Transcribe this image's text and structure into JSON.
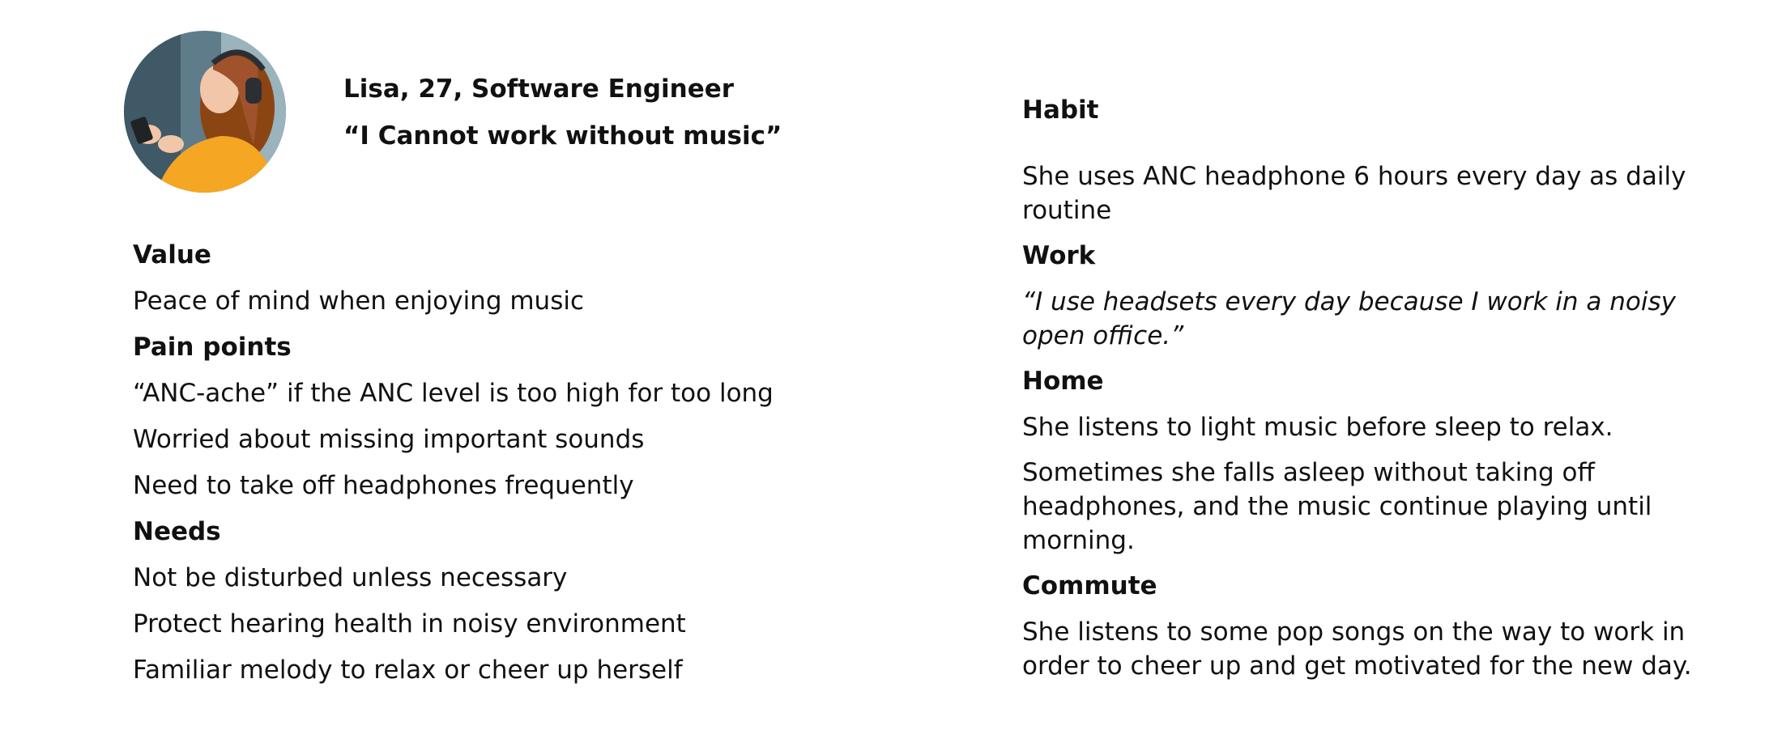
{
  "persona": {
    "name_line": "Lisa, 27, Software Engineer",
    "quote": "“I Cannot work without music”",
    "photo_colors": {
      "background": "#5e7c8a",
      "hair": "#a0522d",
      "jacket": "#f5a623",
      "skin": "#f2c6a8",
      "headphones": "#2b2f33"
    }
  },
  "left": {
    "value_heading": "Value",
    "value_items": [
      "Peace of mind when enjoying music"
    ],
    "pain_heading": "Pain points",
    "pain_items": [
      "“ANC-ache” if the ANC level is too high for too long",
      "Worried about missing important sounds",
      "Need to take off headphones frequently"
    ],
    "needs_heading": "Needs",
    "needs_items": [
      "Not be disturbed unless necessary",
      "Protect hearing health in noisy environment",
      "Familiar melody to relax or cheer up herself"
    ]
  },
  "right": {
    "habit_heading": "Habit",
    "habit_text": "She uses ANC headphone 6 hours every day as daily routine",
    "work_heading": "Work",
    "work_quote": "“I use headsets every day because I work in a noisy open office.”",
    "home_heading": "Home",
    "home_text_1": "She listens to light music before sleep to relax.",
    "home_text_2": "Sometimes she falls asleep without taking off headphones, and the music continue playing until morning.",
    "commute_heading": "Commute",
    "commute_text": "She listens to some pop songs on the way to work in order to cheer up and get motivated for the new day."
  }
}
